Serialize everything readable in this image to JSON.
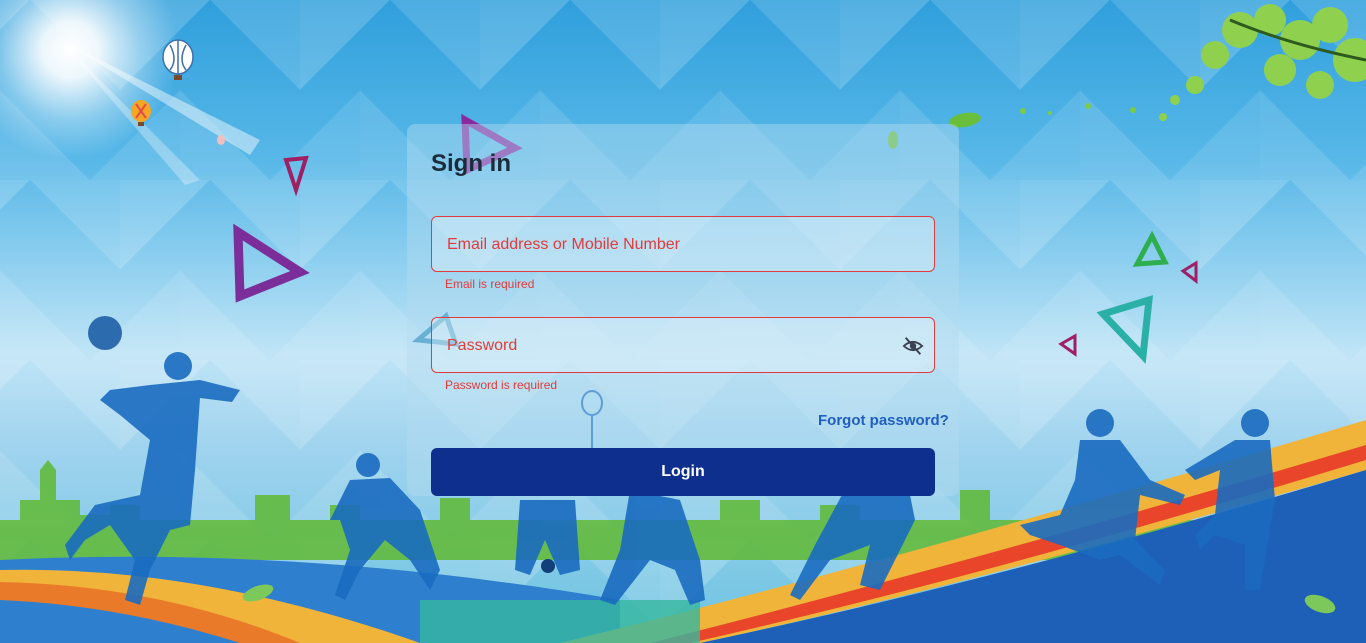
{
  "signin": {
    "title": "Sign in",
    "email": {
      "placeholder": "Email address or Mobile Number",
      "value": "",
      "error": "Email is required"
    },
    "password": {
      "placeholder": "Password",
      "value": "",
      "error": "Password is required",
      "toggle_icon": "eye-off-icon"
    },
    "forgot_label": "Forgot password?",
    "login_label": "Login"
  },
  "colors": {
    "error": "#e23b3b",
    "button": "#0f2f8e",
    "link": "#1f5fc0"
  }
}
